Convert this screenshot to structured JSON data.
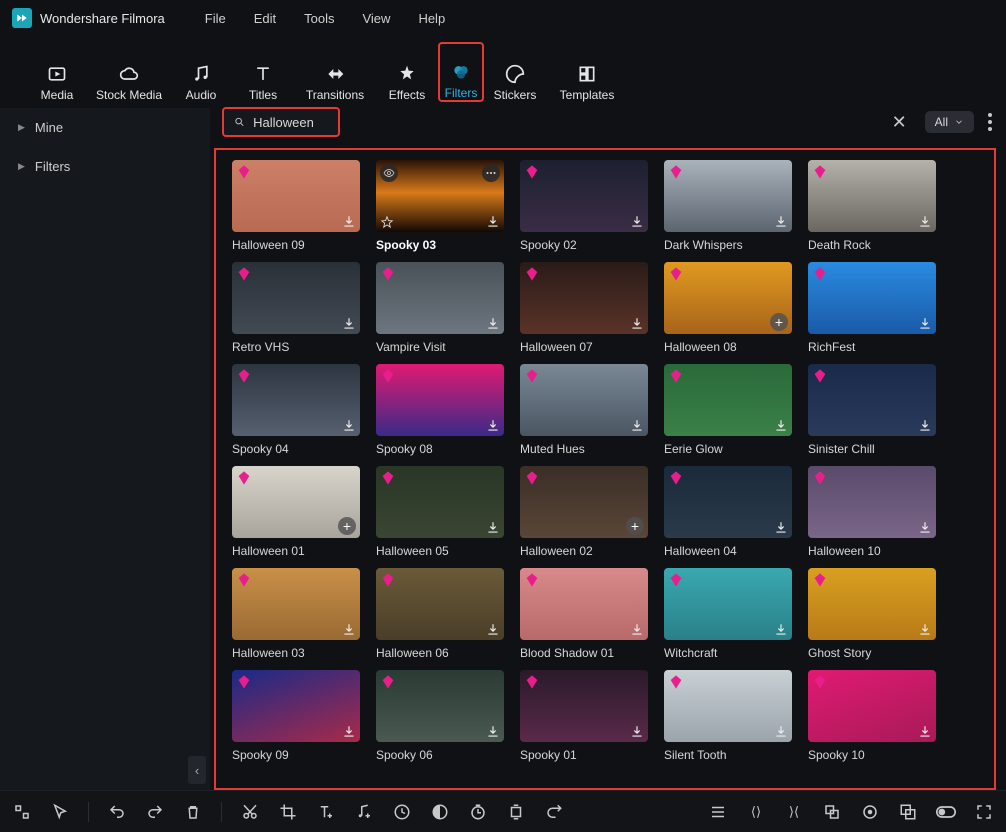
{
  "app": {
    "title": "Wondershare Filmora"
  },
  "menu": [
    "File",
    "Edit",
    "Tools",
    "View",
    "Help"
  ],
  "tabs": [
    {
      "id": "media",
      "label": "Media"
    },
    {
      "id": "stock",
      "label": "Stock Media"
    },
    {
      "id": "audio",
      "label": "Audio"
    },
    {
      "id": "titles",
      "label": "Titles"
    },
    {
      "id": "transitions",
      "label": "Transitions"
    },
    {
      "id": "effects",
      "label": "Effects"
    },
    {
      "id": "filters",
      "label": "Filters",
      "active": true
    },
    {
      "id": "stickers",
      "label": "Stickers"
    },
    {
      "id": "templates",
      "label": "Templates"
    }
  ],
  "search": {
    "value": "Halloween"
  },
  "filter_pill": {
    "label": "All"
  },
  "sidebar": {
    "items": [
      "Mine",
      "Filters"
    ]
  },
  "grid": [
    {
      "label": "Halloween 09",
      "bg": "linear-gradient(180deg,#cc8066,#b86a52)",
      "gem": true,
      "dl": true
    },
    {
      "label": "Spooky 03",
      "bg": "linear-gradient(180deg,#2a1207,#d97a1a 45%,#120804)",
      "eye": true,
      "more": true,
      "star": true,
      "dl": true,
      "bold": true
    },
    {
      "label": "Spooky 02",
      "bg": "linear-gradient(180deg,#1d2030,#3a2d45)",
      "gem": true,
      "dl": true
    },
    {
      "label": "Dark Whispers",
      "bg": "linear-gradient(180deg,#aab2bb,#5b6570)",
      "gem": true,
      "dl": true
    },
    {
      "label": "Death Rock",
      "bg": "linear-gradient(180deg,#b5b2ac,#6a6660)",
      "gem": true,
      "dl": true
    },
    {
      "label": "Retro VHS",
      "bg": "linear-gradient(180deg,#2a3038,#424a54)",
      "gem": true,
      "dl": true
    },
    {
      "label": "Vampire Visit",
      "bg": "linear-gradient(180deg,#4a5158,#6d7680)",
      "gem": true,
      "dl": true
    },
    {
      "label": "Halloween 07",
      "bg": "linear-gradient(180deg,#2a1b18,#5a3328)",
      "gem": true,
      "dl": true
    },
    {
      "label": "Halloween 08",
      "bg": "linear-gradient(180deg,#e09a20,#a8641a)",
      "gem": true,
      "add": true
    },
    {
      "label": "RichFest",
      "bg": "linear-gradient(180deg,#2a8be0,#1a5aa8)",
      "gem": true,
      "dl": true
    },
    {
      "label": "Spooky 04",
      "bg": "linear-gradient(180deg,#2d3540,#566070)",
      "gem": true,
      "dl": true
    },
    {
      "label": "Spooky 08",
      "bg": "linear-gradient(180deg,#e01a72,#3a2a88)",
      "gem": true,
      "dl": true
    },
    {
      "label": "Muted Hues",
      "bg": "linear-gradient(180deg,#7a8896,#4a5662)",
      "gem": true,
      "dl": true
    },
    {
      "label": "Eerie Glow",
      "bg": "linear-gradient(180deg,#2a6a3a,#3a8048)",
      "gem": true,
      "dl": true
    },
    {
      "label": "Sinister Chill",
      "bg": "linear-gradient(180deg,#1a2a4a,#2a3a5a)",
      "gem": true,
      "dl": true
    },
    {
      "label": "Halloween 01",
      "bg": "linear-gradient(180deg,#d8d4cc,#a8a49c)",
      "gem": true,
      "add": true
    },
    {
      "label": "Halloween 05",
      "bg": "linear-gradient(180deg,#2a3626,#3a4632)",
      "gem": true,
      "dl": true
    },
    {
      "label": "Halloween 02",
      "bg": "linear-gradient(180deg,#3a2e26,#5a4638)",
      "gem": true,
      "add": true
    },
    {
      "label": "Halloween 04",
      "bg": "linear-gradient(180deg,#1a2a3a,#2a3a4a)",
      "gem": true,
      "dl": true
    },
    {
      "label": "Halloween 10",
      "bg": "linear-gradient(180deg,#5a4a6a,#7a6688)",
      "gem": true,
      "dl": true
    },
    {
      "label": "Halloween 03",
      "bg": "linear-gradient(180deg,#c89048,#9a6a34)",
      "gem": true,
      "dl": true
    },
    {
      "label": "Halloween 06",
      "bg": "linear-gradient(180deg,#6a5a38,#4a3e28)",
      "gem": true,
      "dl": true
    },
    {
      "label": "Blood Shadow 01",
      "bg": "linear-gradient(180deg,#d88a8a,#b86a6a)",
      "gem": true,
      "dl": true
    },
    {
      "label": "Witchcraft",
      "bg": "linear-gradient(180deg,#3aa8b0,#2a8088)",
      "gem": true,
      "dl": true
    },
    {
      "label": "Ghost Story",
      "bg": "linear-gradient(180deg,#d8a020,#b87a18)",
      "gem": true,
      "dl": true
    },
    {
      "label": "Spooky 09",
      "bg": "linear-gradient(160deg,#1a2a88,#a82a4a)",
      "gem": true,
      "dl": true
    },
    {
      "label": "Spooky 06",
      "bg": "linear-gradient(180deg,#2a3a34,#4a5a52)",
      "gem": true,
      "dl": true
    },
    {
      "label": "Spooky 01",
      "bg": "linear-gradient(180deg,#2a1a2a,#5a2a4a)",
      "gem": true,
      "dl": true
    },
    {
      "label": "Silent Tooth",
      "bg": "linear-gradient(180deg,#c8d0d4,#9aa4aa)",
      "gem": true,
      "dl": true
    },
    {
      "label": "Spooky 10",
      "bg": "linear-gradient(160deg,#e01a72,#a81a58)",
      "gem": true,
      "dl": true
    }
  ]
}
